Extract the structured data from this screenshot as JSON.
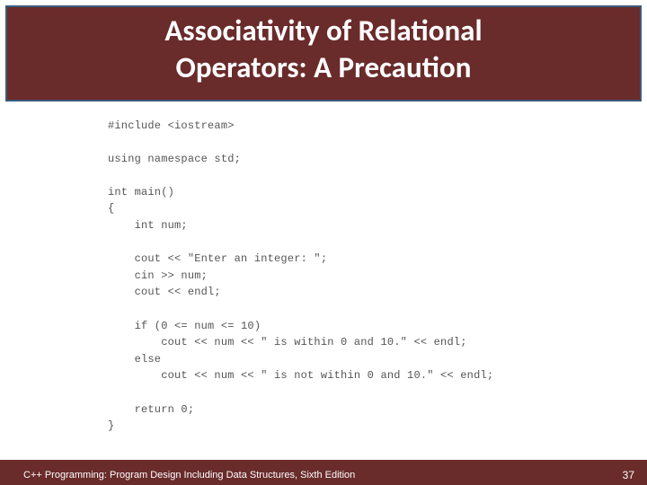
{
  "header": {
    "title_l1": "Associativity of Relational",
    "title_l2": "Operators: A Precaution"
  },
  "code": {
    "l01": "#include <iostream>",
    "l02": "",
    "l03": "using namespace std;",
    "l04": "",
    "l05": "int main()",
    "l06": "{",
    "l07": "    int num;",
    "l08": "",
    "l09": "    cout << \"Enter an integer: \";",
    "l10": "    cin >> num;",
    "l11": "    cout << endl;",
    "l12": "",
    "l13": "    if (0 <= num <= 10)",
    "l14": "        cout << num << \" is within 0 and 10.\" << endl;",
    "l15": "    else",
    "l16": "        cout << num << \" is not within 0 and 10.\" << endl;",
    "l17": "",
    "l18": "    return 0;",
    "l19": "}"
  },
  "footer": {
    "text": "C++ Programming: Program Design Including Data Structures, Sixth Edition",
    "page": "37"
  }
}
